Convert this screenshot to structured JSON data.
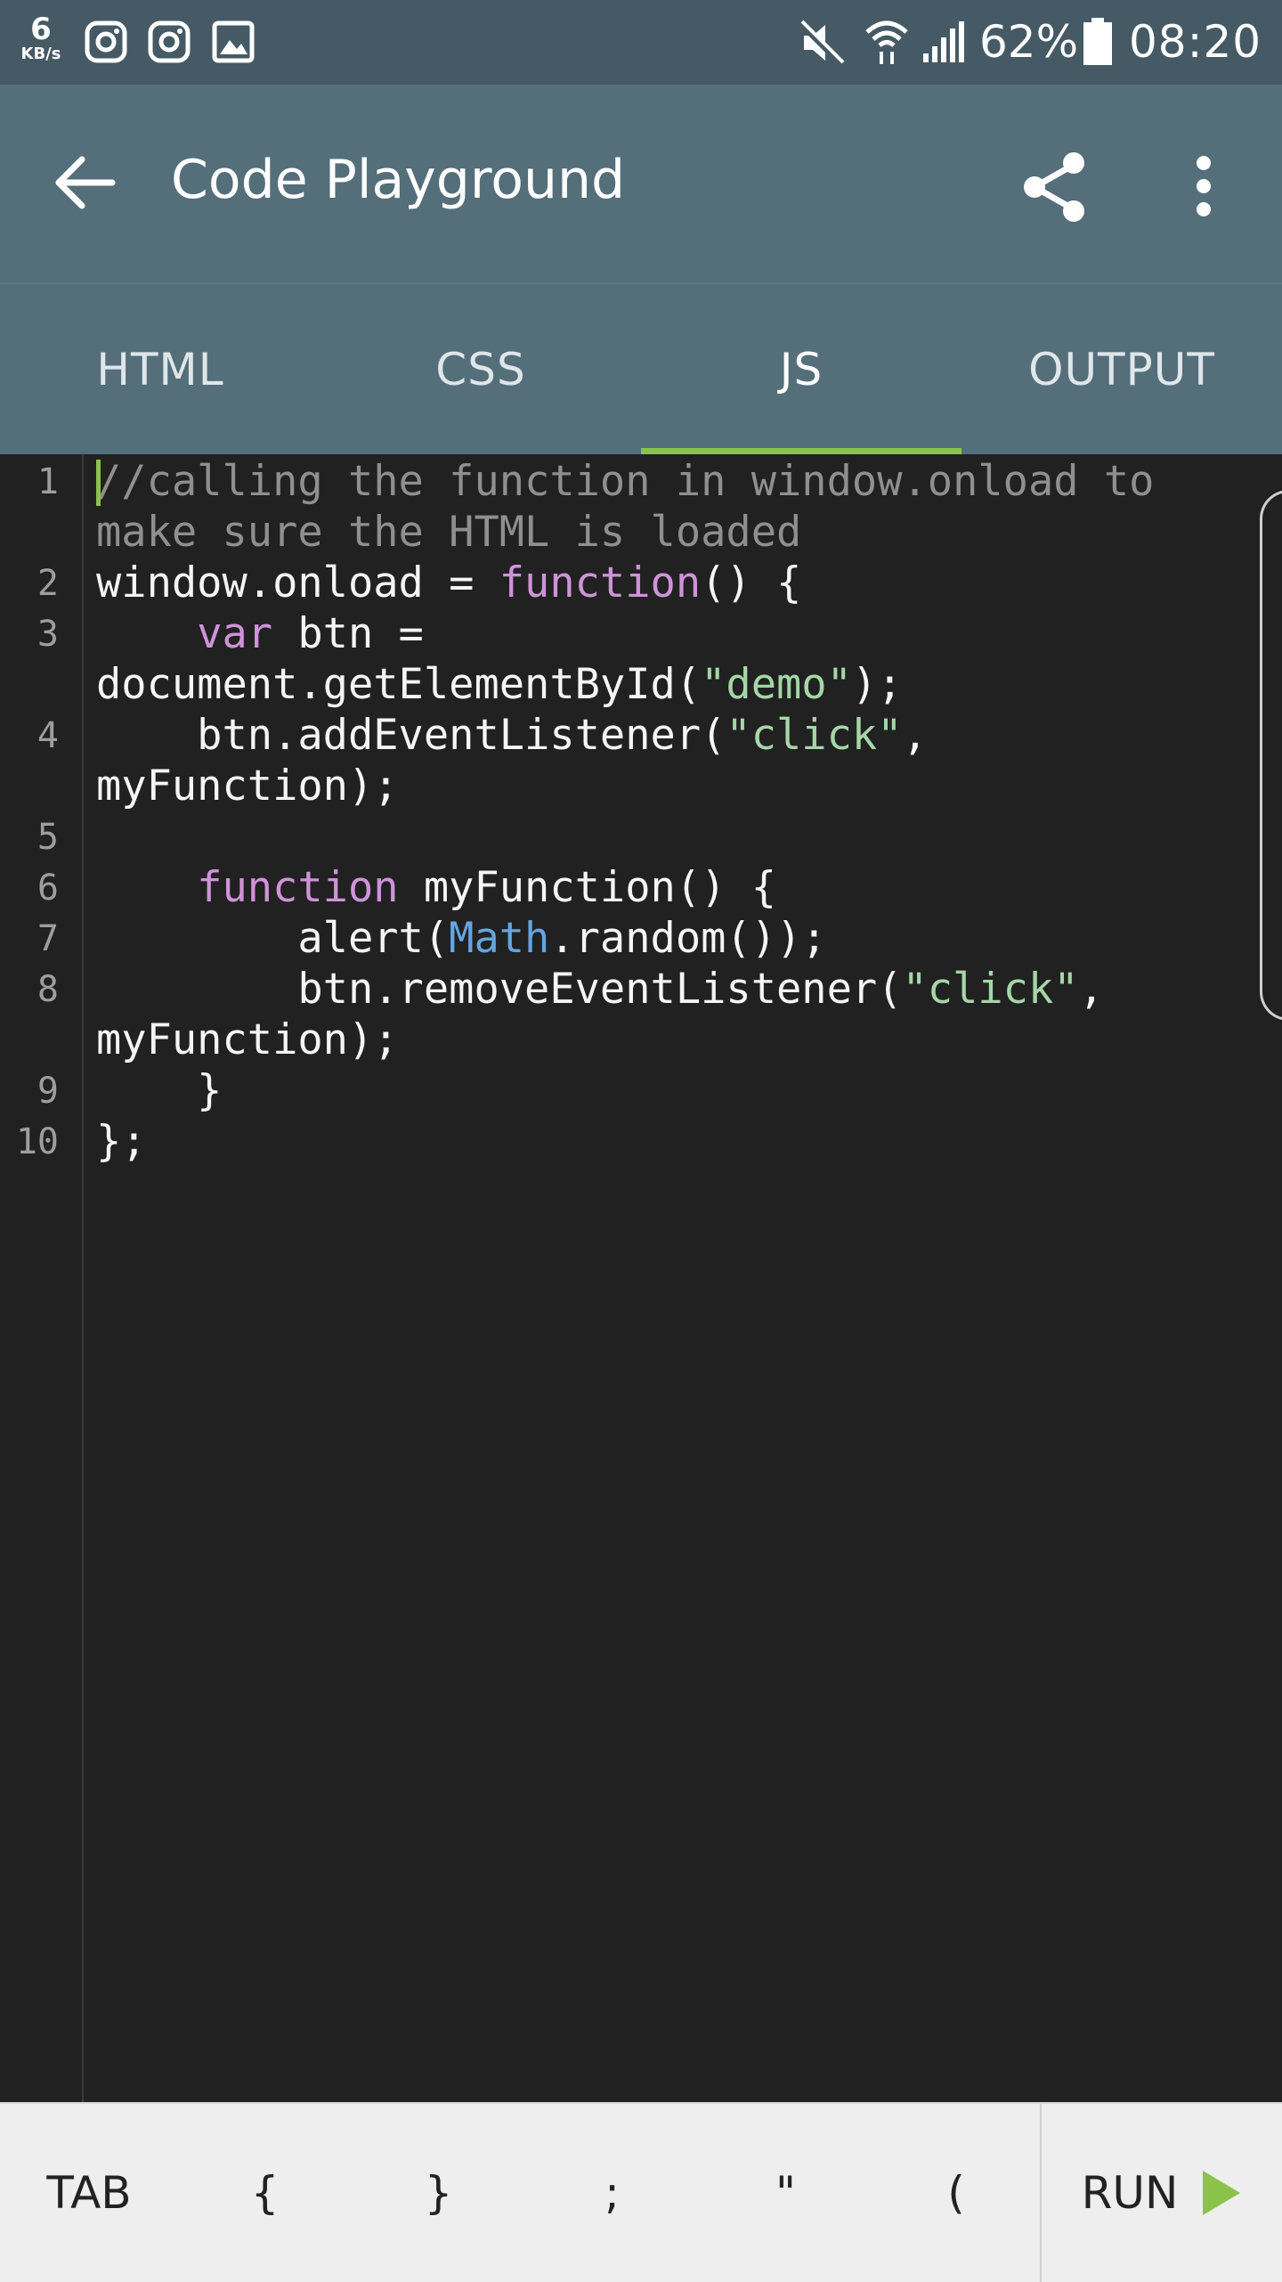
{
  "status_bar": {
    "network_speed": "6",
    "network_unit": "KB/s",
    "left_icons": [
      "instagram-icon",
      "instagram-icon",
      "gallery-icon"
    ],
    "right_icons": [
      "mute-icon",
      "wifi-icon",
      "signal-icon"
    ],
    "battery": "62%",
    "time": "08:20"
  },
  "app_bar": {
    "title": "Code Playground"
  },
  "tabs": [
    {
      "label": "HTML",
      "active": false
    },
    {
      "label": "CSS",
      "active": false
    },
    {
      "label": "JS",
      "active": true
    },
    {
      "label": "OUTPUT",
      "active": false
    }
  ],
  "editor": {
    "line_numbers": [
      "1",
      "2",
      "3",
      "4",
      "5",
      "6",
      "7",
      "8",
      "9",
      "10"
    ],
    "code_lines": [
      {
        "segments": [
          {
            "t": "//calling the function in window.onload to",
            "c": "comment"
          }
        ]
      },
      {
        "segments": [
          {
            "t": "make sure the HTML is loaded",
            "c": "comment"
          }
        ]
      },
      {
        "segments": [
          {
            "t": "window.onload = ",
            "c": "plain"
          },
          {
            "t": "function",
            "c": "kw"
          },
          {
            "t": "() {",
            "c": "plain"
          }
        ]
      },
      {
        "segments": [
          {
            "t": "    ",
            "c": "plain"
          },
          {
            "t": "var",
            "c": "kw"
          },
          {
            "t": " btn =",
            "c": "plain"
          }
        ]
      },
      {
        "segments": [
          {
            "t": "document.getElementById(",
            "c": "plain"
          },
          {
            "t": "\"demo\"",
            "c": "str"
          },
          {
            "t": ");",
            "c": "plain"
          }
        ]
      },
      {
        "segments": [
          {
            "t": "    btn.addEventListener(",
            "c": "plain"
          },
          {
            "t": "\"click\"",
            "c": "str"
          },
          {
            "t": ",",
            "c": "plain"
          }
        ]
      },
      {
        "segments": [
          {
            "t": "myFunction);",
            "c": "plain"
          }
        ]
      },
      {
        "segments": [
          {
            "t": "",
            "c": "plain"
          }
        ]
      },
      {
        "segments": [
          {
            "t": "    ",
            "c": "plain"
          },
          {
            "t": "function",
            "c": "kw"
          },
          {
            "t": " myFunction() {",
            "c": "plain"
          }
        ]
      },
      {
        "segments": [
          {
            "t": "        alert(",
            "c": "plain"
          },
          {
            "t": "Math",
            "c": "blue"
          },
          {
            "t": ".random());",
            "c": "plain"
          }
        ]
      },
      {
        "segments": [
          {
            "t": "        btn.removeEventListener(",
            "c": "plain"
          },
          {
            "t": "\"click\"",
            "c": "str"
          },
          {
            "t": ",",
            "c": "plain"
          }
        ]
      },
      {
        "segments": [
          {
            "t": "myFunction);",
            "c": "plain"
          }
        ]
      },
      {
        "segments": [
          {
            "t": "    }",
            "c": "plain"
          }
        ]
      },
      {
        "segments": [
          {
            "t": "};",
            "c": "plain"
          }
        ]
      }
    ],
    "line_number_rows": [
      0,
      2,
      3,
      5,
      7,
      8,
      9,
      10,
      12,
      13
    ]
  },
  "bottom_bar": {
    "keys": [
      "TAB",
      "{",
      "}",
      ";",
      "\"",
      "("
    ],
    "run_label": "RUN"
  },
  "colors": {
    "status_bar": "#455a64",
    "app_bar": "#546e7a",
    "accent": "#8bc34a",
    "editor_bg": "#212121"
  }
}
